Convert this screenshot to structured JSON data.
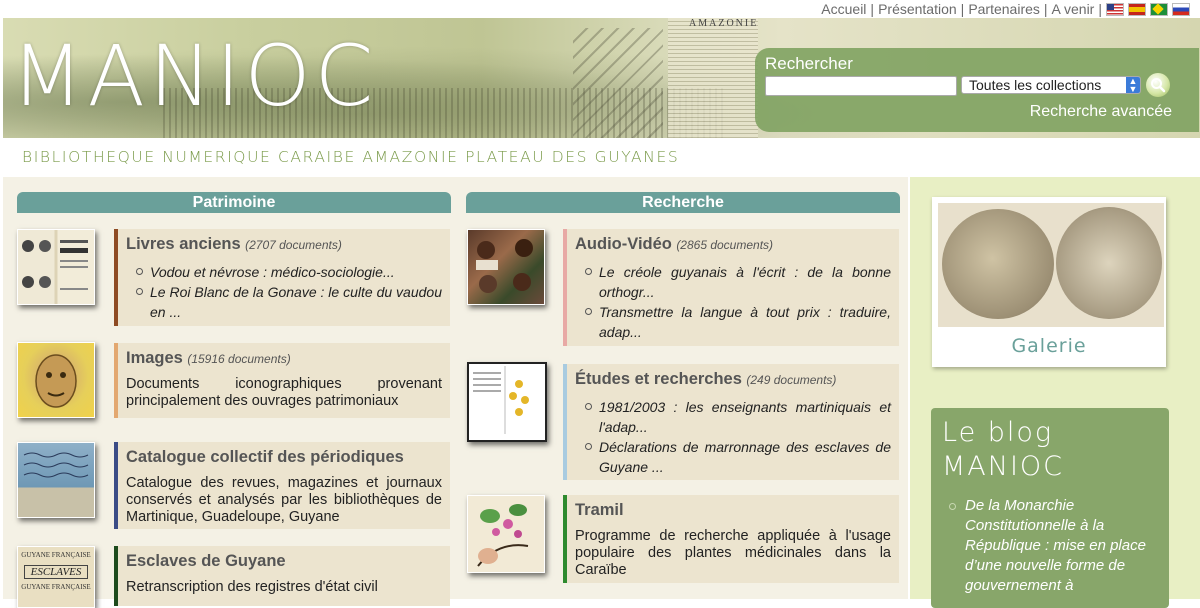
{
  "toplinks": {
    "accueil": "Accueil",
    "presentation": "Présentation",
    "partenaires": "Partenaires",
    "avenir": "A venir",
    "sep": "|",
    "flags": [
      "flag-us-icon",
      "flag-es-icon",
      "flag-br-icon",
      "flag-ru-icon"
    ]
  },
  "banner": {
    "logo": "MANIOC",
    "book_header": "AMAZONIE"
  },
  "search": {
    "label": "Rechercher",
    "value": "",
    "scope": "Toutes les collections",
    "advanced": "Recherche avancée"
  },
  "tagline": "BIBLIOTHEQUE NUMERIQUE CARAIBE AMAZONIE PLATEAU DES GUYANES",
  "patrimoine": {
    "heading": "Patrimoine",
    "items": [
      {
        "title": "Livres anciens",
        "count": "(2707 documents)",
        "links": [
          "Vodou et névrose : médico-sociologie...",
          "Le Roi Blanc de la Gonave : le culte du vaudou en ..."
        ]
      },
      {
        "title": "Images",
        "count": "(15916 documents)",
        "desc": "Documents iconographiques provenant principalement des ouvrages patrimoniaux"
      },
      {
        "title": "Catalogue collectif des périodiques",
        "desc": "Catalogue des revues, magazines et journaux conservés et analysés par les bibliothèques de Martinique, Guadeloupe, Guyane"
      },
      {
        "title": "Esclaves de Guyane",
        "desc": "Retranscription des registres d'état civil"
      }
    ]
  },
  "recherche": {
    "heading": "Recherche",
    "items": [
      {
        "title": "Audio-Vidéo",
        "count": "(2865 documents)",
        "links": [
          "Le créole guyanais à l'écrit : de la bonne orthogr...",
          "Transmettre la langue à tout prix : traduire, adap..."
        ]
      },
      {
        "title": "Études et recherches",
        "count": "(249 documents)",
        "links": [
          "1981/2003 : les enseignants martiniquais et l'adap...",
          "Déclarations de marronnage des esclaves de Guyane ..."
        ]
      },
      {
        "title": "Tramil",
        "desc": "Programme de recherche appliquée à l'usage populaire des plantes médicinales dans la Caraïbe"
      }
    ]
  },
  "thumbs": {
    "esclaves_line1": "GUYANE FRANÇAISE",
    "esclaves_line2": "ESCLAVES"
  },
  "galerie": {
    "label": "Galerie"
  },
  "blog": {
    "title_line1": "Le blog",
    "title_line2": "MANIOC",
    "post": "De la Monarchie Constitutionnelle à la République : mise en place d’une nouvelle forme de gouvernement à"
  },
  "colors": {
    "header_teal": "#6aa09a",
    "green_accent": "#7b9b4b",
    "card_bg": "#ece4cf"
  }
}
